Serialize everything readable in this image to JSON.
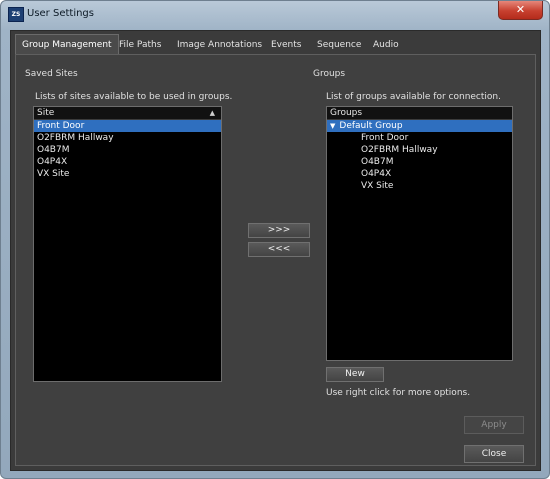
{
  "window": {
    "title": "User Settings",
    "app_icon_text": "ZS",
    "close_glyph": "✕"
  },
  "tabs": [
    {
      "label": "Group Management",
      "active": true
    },
    {
      "label": "File Paths"
    },
    {
      "label": "Image Annotations"
    },
    {
      "label": "Events"
    },
    {
      "label": "Sequence"
    },
    {
      "label": "Audio"
    }
  ],
  "saved_sites": {
    "section_label": "Saved Sites",
    "description": "Lists of sites available to be used in groups.",
    "column_header": "Site",
    "sort_glyph": "▲",
    "items": [
      "Front Door",
      "O2FBRM Hallway",
      "O4B7M",
      "O4P4X",
      "VX Site"
    ],
    "selected_index": 0
  },
  "move_buttons": {
    "add_label": ">>>",
    "remove_label": "<<<"
  },
  "groups": {
    "section_label": "Groups",
    "description": "List of groups available for connection.",
    "column_header": "Groups",
    "expand_glyph": "▼",
    "group_name": "Default Group",
    "children": [
      "Front Door",
      "O2FBRM Hallway",
      "O4B7M",
      "O4P4X",
      "VX Site"
    ],
    "new_button_label": "New",
    "hint": "Use right click for more options."
  },
  "footer": {
    "apply_label": "Apply",
    "close_label": "Close"
  },
  "colors": {
    "selection": "#2f6fbf",
    "panel_background": "#404040",
    "list_background": "#000000"
  }
}
